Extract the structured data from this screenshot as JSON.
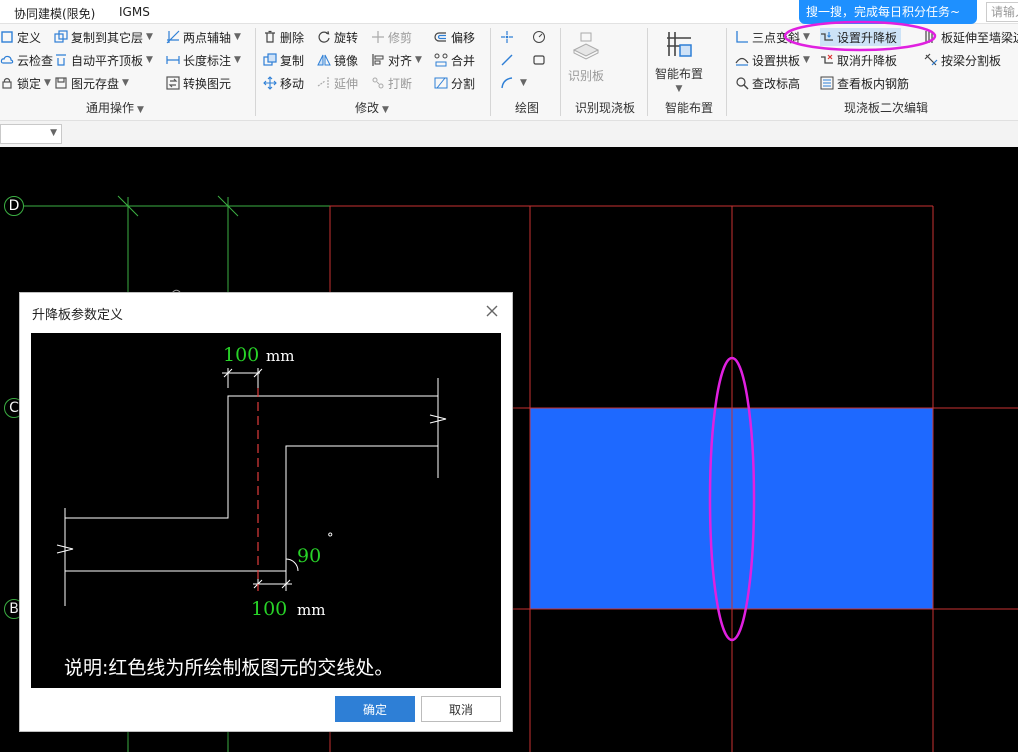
{
  "tabs": [
    "协同建模(限免)",
    "IGMS"
  ],
  "search": {
    "tip": "搜一搜，完成每日积分任务~",
    "placeholder": "请输入"
  },
  "ribbon": {
    "general": {
      "title": "通用操作",
      "col1": [
        "定义",
        "云检查",
        "锁定"
      ],
      "col2": [
        "复制到其它层",
        "自动平齐顶板",
        "图元存盘"
      ],
      "col3": [
        "两点辅轴",
        "长度标注",
        "转换图元"
      ]
    },
    "modify": {
      "title": "修改",
      "col1": [
        "删除",
        "复制",
        "移动"
      ],
      "col2": [
        "旋转",
        "镜像",
        "延伸"
      ],
      "col3": [
        "修剪",
        "对齐",
        "打断"
      ],
      "col4": [
        "偏移",
        "合并",
        "分割"
      ]
    },
    "draw": {
      "title": "绘图"
    },
    "identify": {
      "title": "识别现浇板",
      "button": "识别板"
    },
    "smart": {
      "title": "智能布置",
      "button": "智能布置"
    },
    "edit2": {
      "title": "现浇板二次编辑",
      "col1": [
        "三点变斜",
        "设置拱板",
        "查改标高"
      ],
      "col2": [
        "设置升降板",
        "取消升降板",
        "查看板内钢筋"
      ],
      "col3": [
        "板延伸至墙梁边",
        "按梁分割板"
      ]
    }
  },
  "axes": [
    "D",
    "C",
    "B"
  ],
  "dialog": {
    "title": "升降板参数定义",
    "top_width": "100",
    "bottom_width": "100",
    "angle": "90",
    "unit": "mm",
    "degree": "°",
    "note": "说明:红色线为所绘制板图元的交线处。",
    "ok": "确定",
    "cancel": "取消"
  },
  "colors": {
    "accent": "#2e7fd6",
    "slab": "#1e69ff",
    "highlight": "#e020e0",
    "grid": "#c83232",
    "axis": "#3cb043",
    "value": "#28d228"
  }
}
